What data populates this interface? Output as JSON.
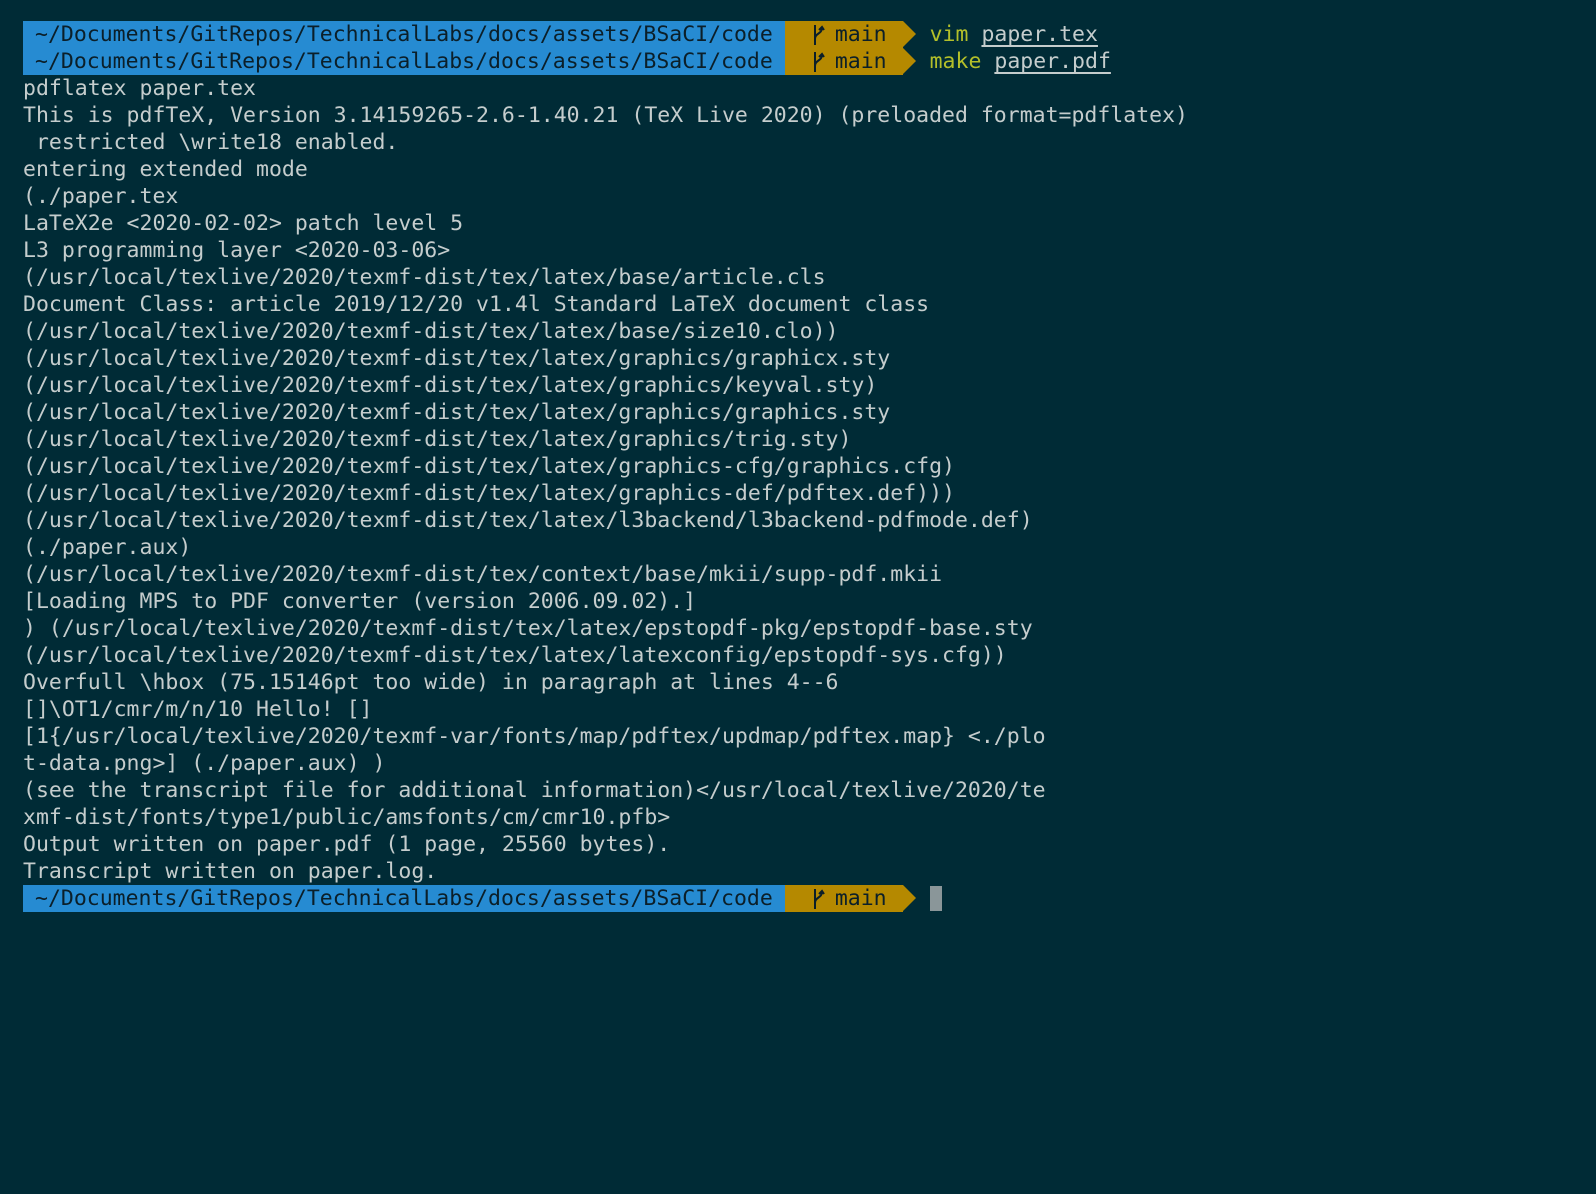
{
  "colors": {
    "background": "#002b36",
    "path_segment": "#268bd2",
    "git_segment": "#b58900",
    "command": "#b3bf2a",
    "text": "#c5cdcd",
    "cursor": "#8a9699"
  },
  "prompts": [
    {
      "path": "~/Documents/GitRepos/TechnicalLabs/docs/assets/BSaCI/code",
      "branch_icon": "git-branch-icon",
      "branch": "main",
      "command": "vim",
      "argument": "paper.tex"
    },
    {
      "path": "~/Documents/GitRepos/TechnicalLabs/docs/assets/BSaCI/code",
      "branch_icon": "git-branch-icon",
      "branch": "main",
      "command": "make",
      "argument": "paper.pdf"
    }
  ],
  "output_lines": [
    "pdflatex paper.tex",
    "This is pdfTeX, Version 3.14159265-2.6-1.40.21 (TeX Live 2020) (preloaded format=pdflatex)",
    " restricted \\write18 enabled.",
    "entering extended mode",
    "(./paper.tex",
    "LaTeX2e <2020-02-02> patch level 5",
    "L3 programming layer <2020-03-06>",
    "(/usr/local/texlive/2020/texmf-dist/tex/latex/base/article.cls",
    "Document Class: article 2019/12/20 v1.4l Standard LaTeX document class",
    "(/usr/local/texlive/2020/texmf-dist/tex/latex/base/size10.clo))",
    "(/usr/local/texlive/2020/texmf-dist/tex/latex/graphics/graphicx.sty",
    "(/usr/local/texlive/2020/texmf-dist/tex/latex/graphics/keyval.sty)",
    "(/usr/local/texlive/2020/texmf-dist/tex/latex/graphics/graphics.sty",
    "(/usr/local/texlive/2020/texmf-dist/tex/latex/graphics/trig.sty)",
    "(/usr/local/texlive/2020/texmf-dist/tex/latex/graphics-cfg/graphics.cfg)",
    "(/usr/local/texlive/2020/texmf-dist/tex/latex/graphics-def/pdftex.def)))",
    "(/usr/local/texlive/2020/texmf-dist/tex/latex/l3backend/l3backend-pdfmode.def)",
    "(./paper.aux)",
    "(/usr/local/texlive/2020/texmf-dist/tex/context/base/mkii/supp-pdf.mkii",
    "[Loading MPS to PDF converter (version 2006.09.02).]",
    ") (/usr/local/texlive/2020/texmf-dist/tex/latex/epstopdf-pkg/epstopdf-base.sty",
    "(/usr/local/texlive/2020/texmf-dist/tex/latex/latexconfig/epstopdf-sys.cfg))",
    "Overfull \\hbox (75.15146pt too wide) in paragraph at lines 4--6",
    "[]\\OT1/cmr/m/n/10 Hello! []",
    "[1{/usr/local/texlive/2020/texmf-var/fonts/map/pdftex/updmap/pdftex.map} <./plo",
    "t-data.png>] (./paper.aux) )",
    "(see the transcript file for additional information)</usr/local/texlive/2020/te",
    "xmf-dist/fonts/type1/public/amsfonts/cm/cmr10.pfb>",
    "Output written on paper.pdf (1 page, 25560 bytes).",
    "Transcript written on paper.log."
  ],
  "final_prompt": {
    "path": "~/Documents/GitRepos/TechnicalLabs/docs/assets/BSaCI/code",
    "branch_icon": "git-branch-icon",
    "branch": "main"
  }
}
